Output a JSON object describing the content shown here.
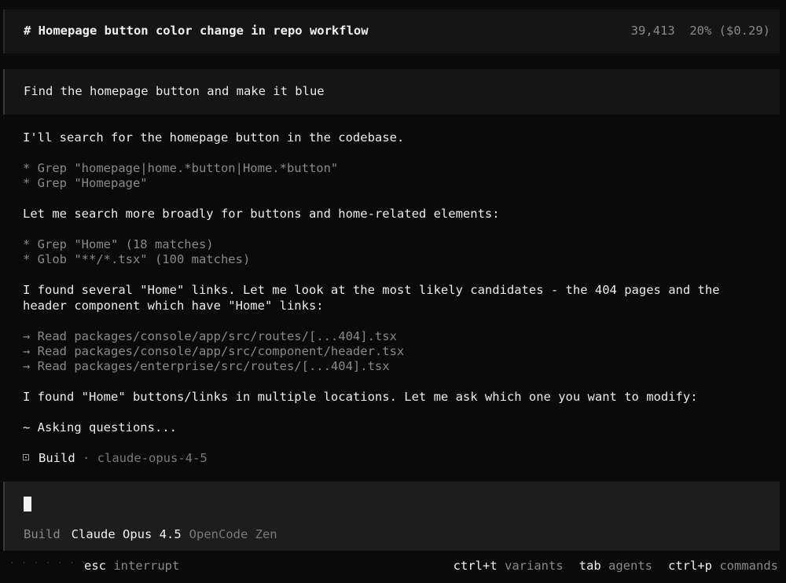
{
  "header": {
    "title": "# Homepage button color change in repo workflow",
    "tokens": "39,413",
    "usage": "20% ($0.29)"
  },
  "user_message": "Find the homepage button and make it blue",
  "transcript": {
    "line1": "I'll search for the homepage button in the codebase.",
    "tool1": "* Grep \"homepage|home.*button|Home.*button\"",
    "tool2": "* Grep \"Homepage\"",
    "line2": "Let me search more broadly for buttons and home-related elements:",
    "tool3": "* Grep \"Home\" (18 matches)",
    "tool4": "* Glob \"**/*.tsx\" (100 matches)",
    "line3a": "I found several \"Home\" links. Let me look at the most likely candidates - the 404 pages and the",
    "line3b": "header component which have \"Home\" links:",
    "read1": "→ Read packages/console/app/src/routes/[...404].tsx",
    "read2": "→ Read packages/console/app/src/component/header.tsx",
    "read3": "→ Read packages/enterprise/src/routes/[...404].tsx",
    "line4": "I found \"Home\" buttons/links in multiple locations. Let me ask which one you want to modify:",
    "line5": "~ Asking questions...",
    "build_label": "Build",
    "build_sep": " · ",
    "build_model": "claude-opus-4-5"
  },
  "input": {
    "agent": "Build",
    "model": "Claude Opus 4.5",
    "provider": "OpenCode Zen"
  },
  "footer": {
    "dots": "· · · · · · · ·",
    "esc_key": "esc",
    "esc_desc": "interrupt",
    "variants_key": "ctrl+t",
    "variants_desc": "variants",
    "agents_key": "tab",
    "agents_desc": "agents",
    "commands_key": "ctrl+p",
    "commands_desc": "commands"
  },
  "colors": {
    "background": "#0a0a0a",
    "panel": "#151515",
    "input_panel": "#1d1d1d",
    "muted_text": "#8a8a8a"
  }
}
